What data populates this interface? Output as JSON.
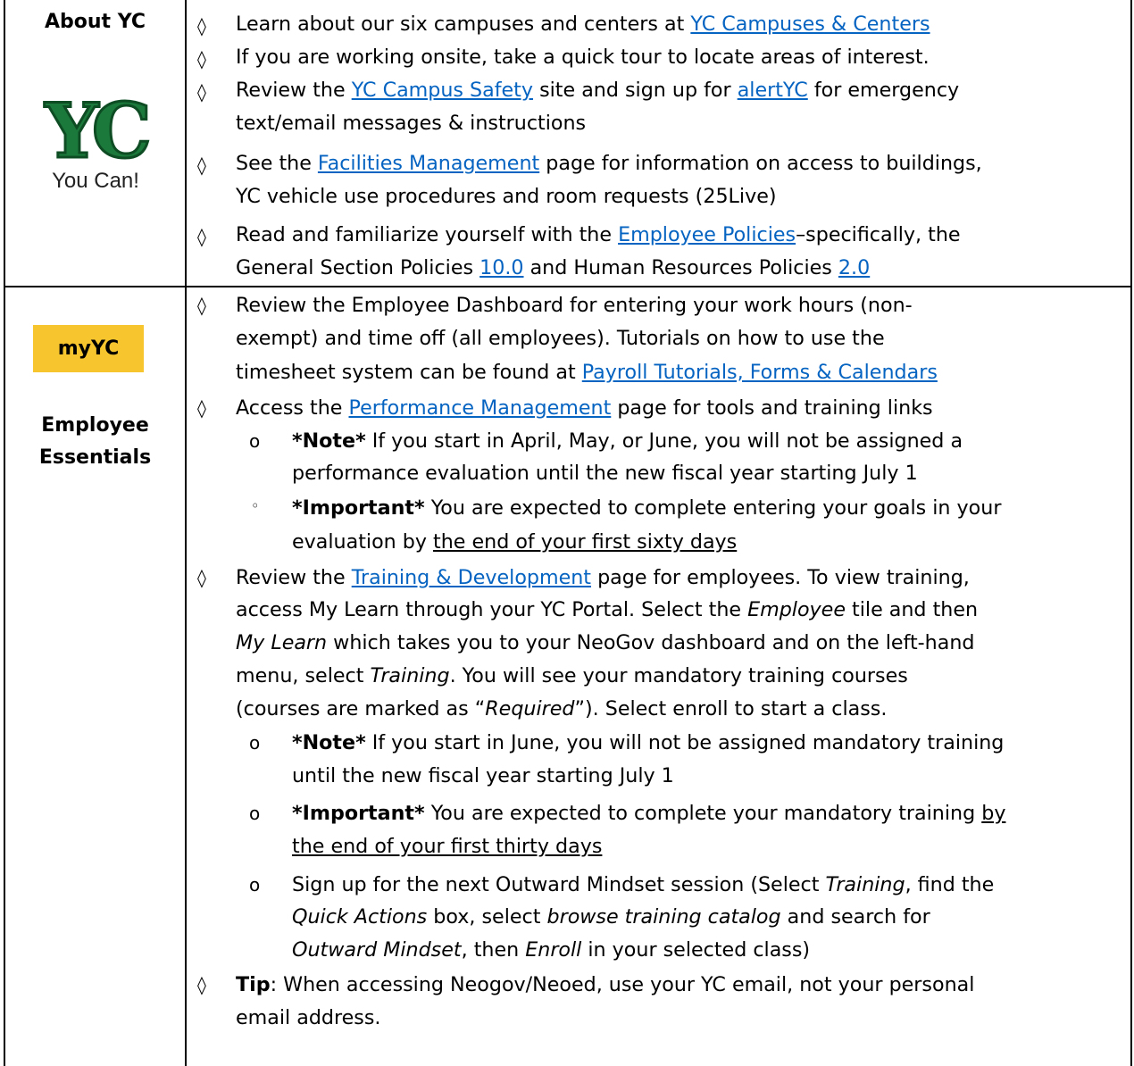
{
  "about": {
    "label": "About YC",
    "logo_text": "YC",
    "logo_tagline": "You Can!",
    "bullets": [
      [
        "Learn about our six campuses and centers at ",
        "YC Campuses & Centers"
      ],
      [
        "If you are working onsite, take a quick tour to locate areas of interest."
      ],
      [
        "Review the ",
        "YC Campus Safety",
        " site and sign up for ",
        "alertYC",
        " for emergency"
      ],
      [
        "text/email messages & instructions"
      ],
      [
        "See the ",
        "Facilities Management",
        "  page for information on access to buildings,"
      ],
      [
        "YC vehicle use procedures and room requests (25Live)"
      ],
      [
        "Read and familiarize yourself with the ",
        "Employee Policies",
        "–specifically, the"
      ],
      [
        "General Section Policies ",
        "10.0",
        " and Human Resources Policies ",
        "2.0"
      ]
    ]
  },
  "essentials": {
    "badge": "myYC",
    "label_line1": "Employee",
    "label_line2": "Essentials",
    "lines": {
      "l1": "Review the Employee Dashboard for entering your work hours (non-",
      "l2": "exempt) and time off (all employees). Tutorials on how to use the",
      "l3a": "timesheet system can be found at ",
      "l3b": "Payroll Tutorials, Forms & Calendars",
      "l4a": "Access the ",
      "l4b": "Performance Management",
      "l4c": " page for tools and training links",
      "l5a": "*Note*",
      "l5b": " If you start in April, May, or June, you will not be assigned a",
      "l6": "performance evaluation until the new fiscal year starting July 1",
      "l7a": "*Important*",
      "l7b": " You are expected to complete entering your goals in your",
      "l8a": "evaluation by ",
      "l8b": "the end of your first sixty days",
      "l9a": "Review the ",
      "l9b": "Training & Development",
      "l9c": " page for employees. To view training,",
      "l10": "access My Learn through your YC Portal. Select the ",
      "l10b": "Employee",
      "l10c": " tile and then",
      "l11a": "My Learn",
      "l11b": " which takes you to your NeoGov dashboard and on the left-hand",
      "l12a": "menu, select ",
      "l12b": "Training",
      "l12c": ". You will see your mandatory training courses",
      "l13a": "(courses are marked as “",
      "l13b": "Required",
      "l13c": "”). Select enroll to start a class.",
      "l14a": "*Note*",
      "l14b": " If you start in June, you will not be assigned mandatory training",
      "l15": "until the new fiscal year starting July 1",
      "l16a": "*Important*",
      "l16b": " You are expected to complete your mandatory training ",
      "l16c": "by",
      "l17": "the end of your first thirty days",
      "l18a": "Sign up for the next Outward Mindset session (Select ",
      "l18b": "Training",
      "l18c": ", find the",
      "l19a": "Quick Actions",
      "l19b": " box, select ",
      "l19c": "browse training catalog",
      "l19d": " and search for",
      "l20a": "Outward Mindset",
      "l20b": ", then ",
      "l20c": "Enroll",
      "l20d": " in your selected class)",
      "l21a": "Tip",
      "l21b": ": When accessing Neogov/Neoed, use your YC email, not your personal",
      "l22": "email address."
    },
    "diamond": "◊",
    "sub_o": "o",
    "sub_circle": "◦"
  }
}
